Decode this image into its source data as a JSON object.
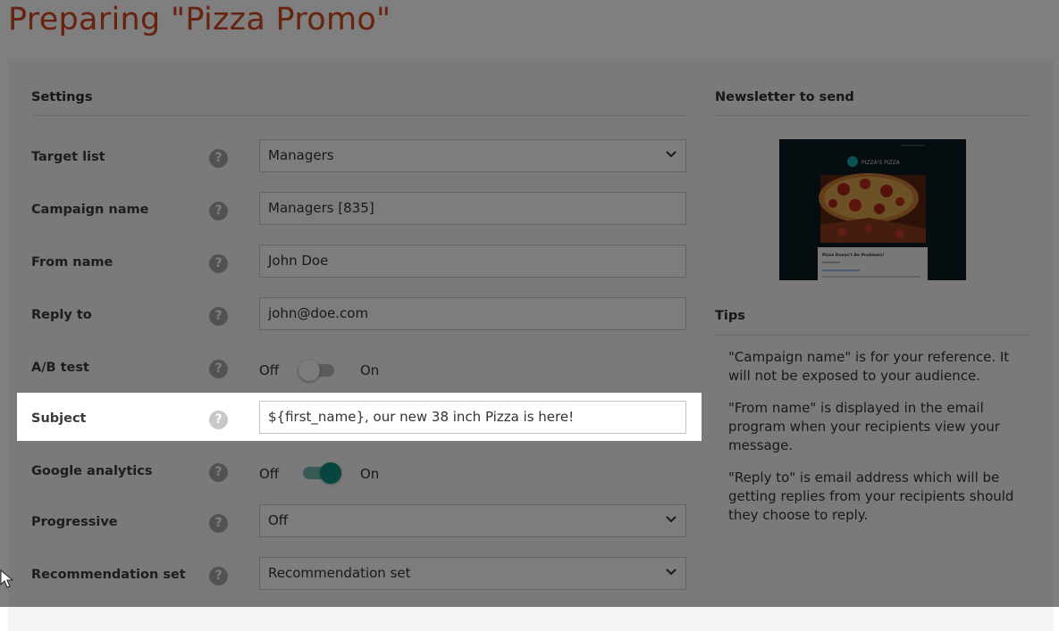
{
  "page": {
    "title": "Preparing \"Pizza Promo\""
  },
  "settings": {
    "title": "Settings",
    "target_list": {
      "label": "Target list",
      "value": "Managers"
    },
    "campaign_name": {
      "label": "Campaign name",
      "value": "Managers [835]"
    },
    "from_name": {
      "label": "From name",
      "value": "John Doe"
    },
    "reply_to": {
      "label": "Reply to",
      "value": "john@doe.com"
    },
    "ab_test": {
      "label": "A/B test",
      "off": "Off",
      "on": "On",
      "state": "off"
    },
    "subject": {
      "label": "Subject",
      "value": "${first_name}, our new 38 inch Pizza is here!"
    },
    "google_analytics": {
      "label": "Google analytics",
      "off": "Off",
      "on": "On",
      "state": "on"
    },
    "progressive": {
      "label": "Progressive",
      "value": "Off"
    },
    "recommendation_set": {
      "label": "Recommendation set",
      "value": "Recommendation set"
    },
    "help_glyph": "?"
  },
  "newsletter": {
    "title": "Newsletter to send",
    "thumbnail": {
      "logo_text": "PIZZA'S PIZZA",
      "headline": "Pizza Doesn't Be Problems!"
    }
  },
  "tips": {
    "title": "Tips",
    "items": [
      "\"Campaign name\" is for your reference. It will not be exposed to your audience.",
      "\"From name\" is displayed in the email program when your recipients view your message.",
      "\"Reply to\" is email address which will be getting replies from your recipients should they choose to reply."
    ]
  },
  "colors": {
    "title": "#d0461c",
    "accent": "#0f8a7e",
    "overlay": "rgba(0,0,0,0.5)"
  },
  "icons": {
    "help": "question-circle-icon",
    "dropdown": "chevron-down-icon",
    "cursor": "mouse-pointer-icon"
  }
}
